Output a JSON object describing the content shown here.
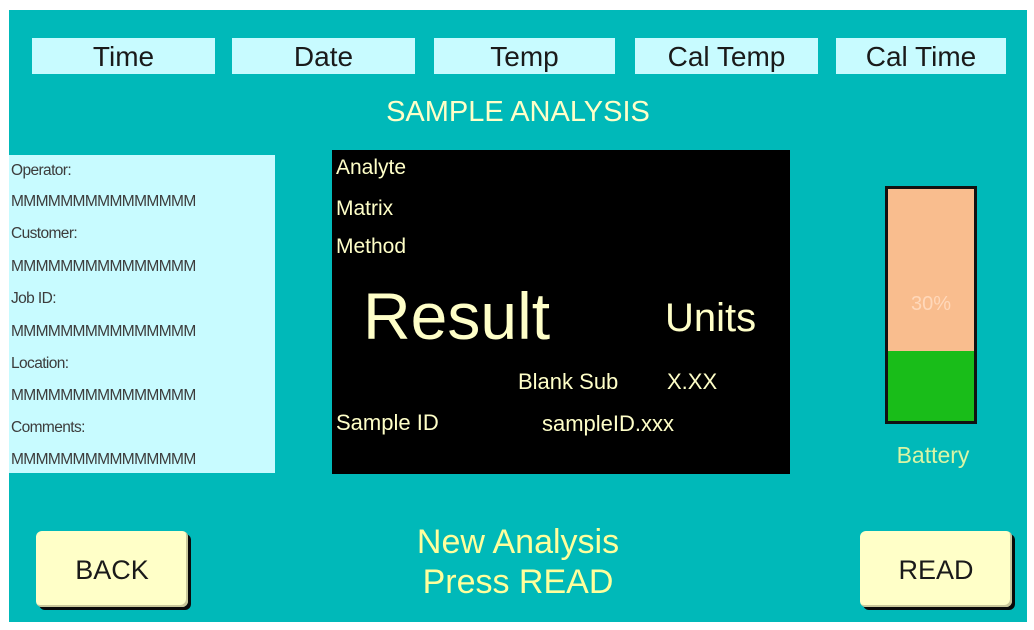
{
  "header": {
    "time_label": "Time",
    "date_label": "Date",
    "temp_label": "Temp",
    "cal_temp_label": "Cal Temp",
    "cal_time_label": "Cal Time"
  },
  "page_title": "SAMPLE ANALYSIS",
  "info_panel": {
    "operator_label": "Operator:",
    "operator_value": "MMMMMMMMMMMMMMM",
    "customer_label": "Customer:",
    "customer_value": "MMMMMMMMMMMMMMM",
    "job_id_label": "Job ID:",
    "job_id_value": "MMMMMMMMMMMMMMM",
    "location_label": "Location:",
    "location_value": "MMMMMMMMMMMMMMM",
    "comments_label": "Comments:",
    "comments_value": "MMMMMMMMMMMMMMM"
  },
  "display": {
    "analyte": "Analyte",
    "matrix": "Matrix",
    "method": "Method",
    "result": "Result",
    "units": "Units",
    "blank_sub_label": "Blank Sub",
    "blank_sub_value": "X.XX",
    "sample_id_label": "Sample ID",
    "sample_id_value": "sampleID.xxx"
  },
  "battery": {
    "label": "Battery",
    "percent_text": "30%",
    "level": 0.3,
    "fill_color": "#19bd19",
    "empty_color": "#f9bd8e"
  },
  "status_message": {
    "line1": "New Analysis",
    "line2": "Press READ"
  },
  "buttons": {
    "back_label": "BACK",
    "read_label": "READ"
  },
  "colors": {
    "background": "#00b9b9",
    "panel": "#c8fbff",
    "accent_text": "#ffffc8",
    "display_bg": "#000000"
  }
}
